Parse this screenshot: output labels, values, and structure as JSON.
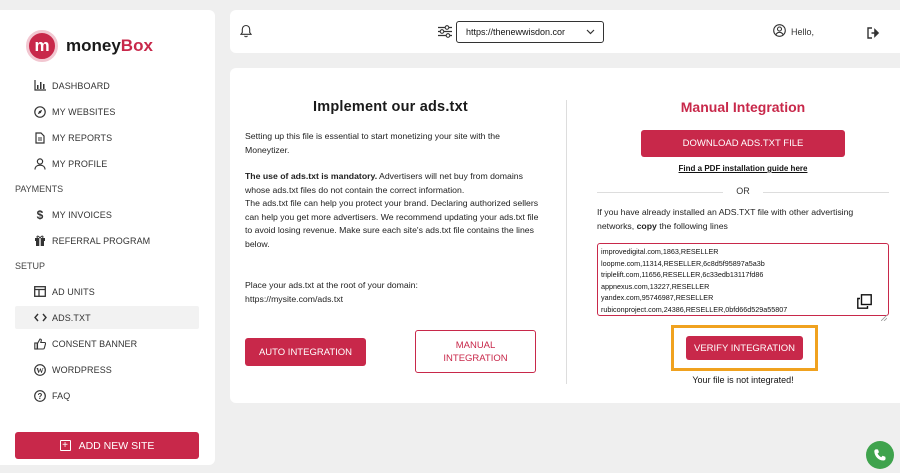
{
  "brand": {
    "logo_letter": "m",
    "name_part1": "money",
    "name_part2": "Box",
    "accent": "#c8284a"
  },
  "sidebar": {
    "items_main": [
      {
        "label": "DASHBOARD",
        "icon": "bar-chart-icon"
      },
      {
        "label": "MY WEBSITES",
        "icon": "compass-icon"
      },
      {
        "label": "MY REPORTS",
        "icon": "document-icon"
      },
      {
        "label": "MY PROFILE",
        "icon": "user-icon"
      }
    ],
    "section_payments": "PAYMENTS",
    "items_payments": [
      {
        "label": "MY INVOICES",
        "icon": "dollar-icon"
      },
      {
        "label": "REFERRAL PROGRAM",
        "icon": "gift-icon"
      }
    ],
    "section_setup": "SETUP",
    "items_setup": [
      {
        "label": "AD UNITS",
        "icon": "layout-icon"
      },
      {
        "label": "ADS.TXT",
        "icon": "code-icon"
      },
      {
        "label": "CONSENT BANNER",
        "icon": "thumbs-up-icon"
      },
      {
        "label": "WORDPRESS",
        "icon": "wordpress-icon"
      },
      {
        "label": "FAQ",
        "icon": "question-icon"
      }
    ],
    "add_site": "ADD NEW SITE"
  },
  "topbar": {
    "site_url": "https://thenewwisdon.cor",
    "greeting": "Hello,"
  },
  "left": {
    "title": "Implement our ads.txt",
    "intro": "Setting up this file is essential to start monetizing your site with the Moneytizer.",
    "mandatory_bold": "The use of ads.txt is mandatory.",
    "mandatory_rest": " Advertisers will net buy from domains whose ads.txt files do not contain the correct information.",
    "help": "The ads.txt file can help you protect your brand. Declaring authorized sellers can help you get more advertisers. We recommend updating your ads.txt file to avoid losing revenue. Make sure each site's ads.txt file contains the lines below.",
    "place_line1": "Place your ads.txt at the root of your domain:",
    "place_line2": "https://mysite.com/ads.txt",
    "auto_button": "AUTO INTEGRATION",
    "manual_button_line1": "MANUAL",
    "manual_button_line2": "INTEGRATION"
  },
  "right": {
    "title": "Manual Integration",
    "download_button": "DOWNLOAD ADS.TXT FILE",
    "pdf_link": "Find a PDF installation guide here",
    "or": "OR",
    "copy_prefix": "If you have already installed an ADS.TXT file with other advertising networks, ",
    "copy_bold": "copy",
    "copy_suffix": " the following lines",
    "ads_lines": [
      "improvedigital.com,1863,RESELLER",
      "loopme.com,11314,RESELLER,6c8d5f95897a5a3b",
      "triplelift.com,11656,RESELLER,6c33edb13117fd86",
      "appnexus.com,13227,RESELLER",
      "yandex.com,95746987,RESELLER",
      "rubiconproject.com,24386,RESELLER,0bfd66d529a55807"
    ],
    "verify_button": "VERIFY INTEGRATION",
    "status": "Your file is not integrated!"
  }
}
